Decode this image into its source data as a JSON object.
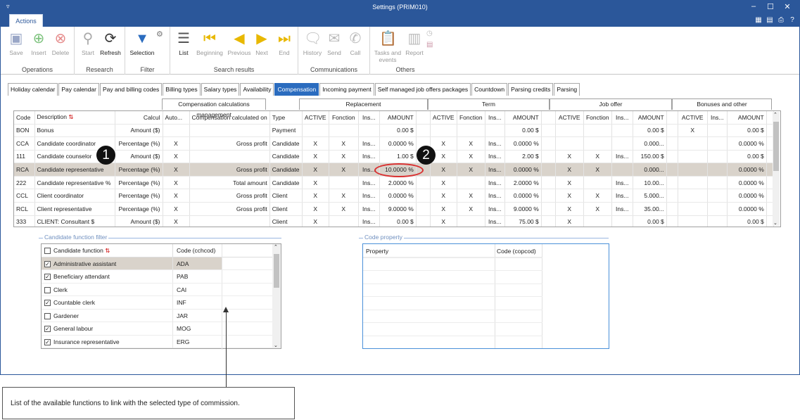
{
  "window": {
    "title": "Settings (PRIM010)",
    "ribbon_tab": "Actions"
  },
  "ribbon": {
    "groups": [
      {
        "label": "Operations",
        "buttons": [
          {
            "label": "Save"
          },
          {
            "label": "Insert"
          },
          {
            "label": "Delete"
          }
        ]
      },
      {
        "label": "Research",
        "buttons": [
          {
            "label": "Start"
          },
          {
            "label": "Refresh"
          }
        ]
      },
      {
        "label": "Filter",
        "buttons": [
          {
            "label": "Selection"
          }
        ]
      },
      {
        "label": "Search results",
        "buttons": [
          {
            "label": "List"
          },
          {
            "label": "Beginning"
          },
          {
            "label": "Previous"
          },
          {
            "label": "Next"
          },
          {
            "label": "End"
          }
        ]
      },
      {
        "label": "Communications",
        "buttons": [
          {
            "label": "History"
          },
          {
            "label": "Send"
          },
          {
            "label": "Call"
          }
        ]
      },
      {
        "label": "Others",
        "buttons": [
          {
            "label": "Tasks and events"
          },
          {
            "label": "Report"
          }
        ]
      }
    ]
  },
  "tabs": [
    "Holiday calendar",
    "Pay calendar",
    "Pay and billing codes",
    "Billing types",
    "Salary types",
    "Availability",
    "Compensation",
    "Incoming payment",
    "Self managed job offers packages",
    "Countdown",
    "Parsing credits",
    "Parsing"
  ],
  "selected_tab": "Compensation",
  "grid": {
    "group_headers": [
      "Compensation calculations management",
      "Replacement",
      "Term",
      "Job offer",
      "Bonuses and other"
    ],
    "columns": [
      "Code",
      "Description",
      "Calcul",
      "Auto...",
      "Compensation calculated on",
      "Type",
      "ACTIVE",
      "Fonction",
      "Ins...",
      "AMOUNT",
      "ACTIVE",
      "Fonction",
      "Ins...",
      "AMOUNT",
      "ACTIVE",
      "Fonction",
      "Ins...",
      "AMOUNT",
      "ACTIVE",
      "Ins...",
      "AMOUNT"
    ],
    "rows": [
      [
        "BON",
        "Bonus",
        "Amount ($)",
        "",
        "",
        "Payment",
        "",
        "",
        "",
        "0.00 $",
        "",
        "",
        "",
        "0.00 $",
        "",
        "",
        "",
        "0.00 $",
        "X",
        "",
        "0.00 $"
      ],
      [
        "CCA",
        "Candidate  coordinator",
        "Percentage (%)",
        "X",
        "Gross profit",
        "Candidate",
        "X",
        "X",
        "Ins...",
        "0.0000 %",
        "X",
        "X",
        "Ins...",
        "0.0000 %",
        "",
        "",
        "",
        "0.000...",
        "",
        "",
        "0.0000 %"
      ],
      [
        "111",
        "Candidate counselor",
        "Amount ($)",
        "X",
        "",
        "Candidate",
        "X",
        "X",
        "Ins...",
        "1.00 $",
        "X",
        "X",
        "Ins...",
        "2.00 $",
        "X",
        "X",
        "Ins...",
        "150.00 $",
        "",
        "",
        "0.00 $"
      ],
      [
        "RCA",
        "Candidate representative",
        "Percentage (%)",
        "X",
        "Gross profit",
        "Candidate",
        "X",
        "X",
        "Ins...",
        "10.0000 %",
        "X",
        "X",
        "Ins...",
        "0.0000 %",
        "X",
        "X",
        "",
        "0.000...",
        "",
        "",
        "0.0000 %"
      ],
      [
        "222",
        "Candidate representative %",
        "Percentage (%)",
        "X",
        "Total amount",
        "Candidate",
        "X",
        "",
        "Ins...",
        "2.0000 %",
        "X",
        "",
        "Ins...",
        "2.0000 %",
        "X",
        "",
        "Ins...",
        "10.00...",
        "",
        "",
        "0.0000 %"
      ],
      [
        "CCL",
        "Client coordinator",
        "Percentage (%)",
        "X",
        "Gross profit",
        "Client",
        "X",
        "X",
        "Ins...",
        "0.0000 %",
        "X",
        "X",
        "Ins...",
        "0.0000 %",
        "X",
        "X",
        "Ins...",
        "5.000...",
        "",
        "",
        "0.0000 %"
      ],
      [
        "RCL",
        "Client representative",
        "Percentage (%)",
        "X",
        "Gross profit",
        "Client",
        "X",
        "X",
        "Ins...",
        "9.0000 %",
        "X",
        "X",
        "Ins...",
        "9.0000 %",
        "X",
        "X",
        "Ins...",
        "35.00...",
        "",
        "",
        "0.0000 %"
      ],
      [
        "333",
        "CLIENT: Consultant $",
        "Amount ($)",
        "X",
        "",
        "Client",
        "X",
        "",
        "Ins...",
        "0.00 $",
        "X",
        "",
        "Ins...",
        "75.00 $",
        "X",
        "",
        "",
        "0.00 $",
        "",
        "",
        "0.00 $"
      ]
    ],
    "highlight_row": 3
  },
  "markers": [
    "1",
    "2"
  ],
  "function_filter": {
    "legend": "Candidate function filter",
    "headers": [
      "Candidate function",
      "Code (cchcod)"
    ],
    "items": [
      {
        "label": "Administrative assistant",
        "code": "ADA",
        "checked": true
      },
      {
        "label": "Beneficiary attendant",
        "code": "PAB",
        "checked": true
      },
      {
        "label": "Clerk",
        "code": "CAI",
        "checked": false
      },
      {
        "label": "Countable clerk",
        "code": "INF",
        "checked": true
      },
      {
        "label": "Gardener",
        "code": "JAR",
        "checked": false
      },
      {
        "label": "General labour",
        "code": "MOG",
        "checked": true
      },
      {
        "label": "Insurance representative",
        "code": "ERG",
        "checked": true
      }
    ]
  },
  "code_property": {
    "legend": "Code property",
    "headers": [
      "Property",
      "Code (copcod)"
    ]
  },
  "callout": "List of the available functions to link with the selected type of commission."
}
